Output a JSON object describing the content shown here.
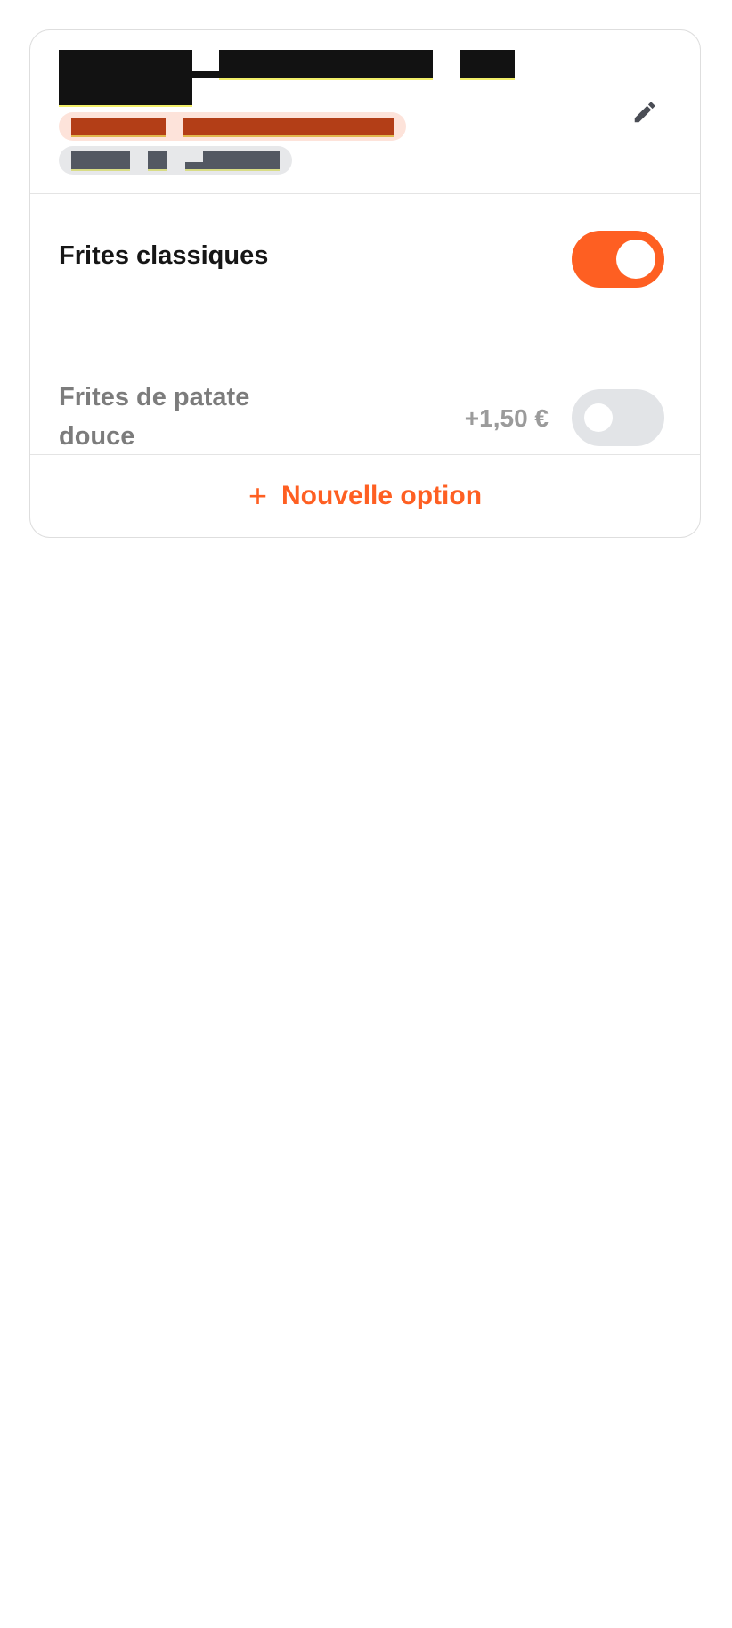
{
  "card": {
    "edit_icon": "pencil-icon",
    "options": [
      {
        "name": "Frites classiques",
        "price": "",
        "enabled": true
      },
      {
        "name": "Frites de patate douce",
        "price": "+1,50 €",
        "enabled": false
      }
    ],
    "add_option": {
      "icon": "plus-icon",
      "label": "Nouvelle option"
    }
  },
  "colors": {
    "accent": "#fe5f22",
    "toggle_off": "#e2e4e7",
    "border": "#dedede",
    "text_primary": "#161616",
    "text_muted": "#7c7c7c"
  }
}
